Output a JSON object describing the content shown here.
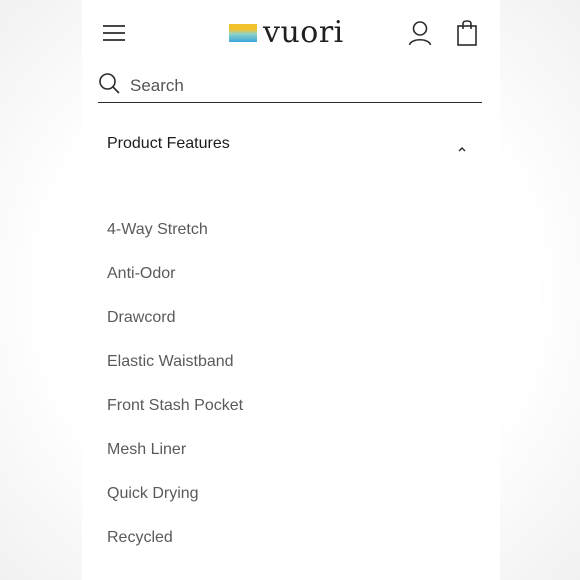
{
  "header": {
    "menu_icon": "hamburger-menu-icon",
    "logo_text": "vuori",
    "account_icon": "user-icon",
    "bag_icon": "shopping-bag-icon"
  },
  "search": {
    "placeholder": "Search",
    "value": ""
  },
  "accordion": {
    "title": "Product Features",
    "expanded": true,
    "items": [
      "4-Way Stretch",
      "Anti-Odor",
      "Drawcord",
      "Elastic Waistband",
      "Front Stash Pocket",
      "Mesh Liner",
      "Quick Drying",
      "Recycled"
    ]
  },
  "colors": {
    "text_dark": "#1c1c1c",
    "text_muted": "#5a5a5a",
    "logo_yellow": "#f2c12e",
    "logo_blue": "#3aa6dd"
  }
}
